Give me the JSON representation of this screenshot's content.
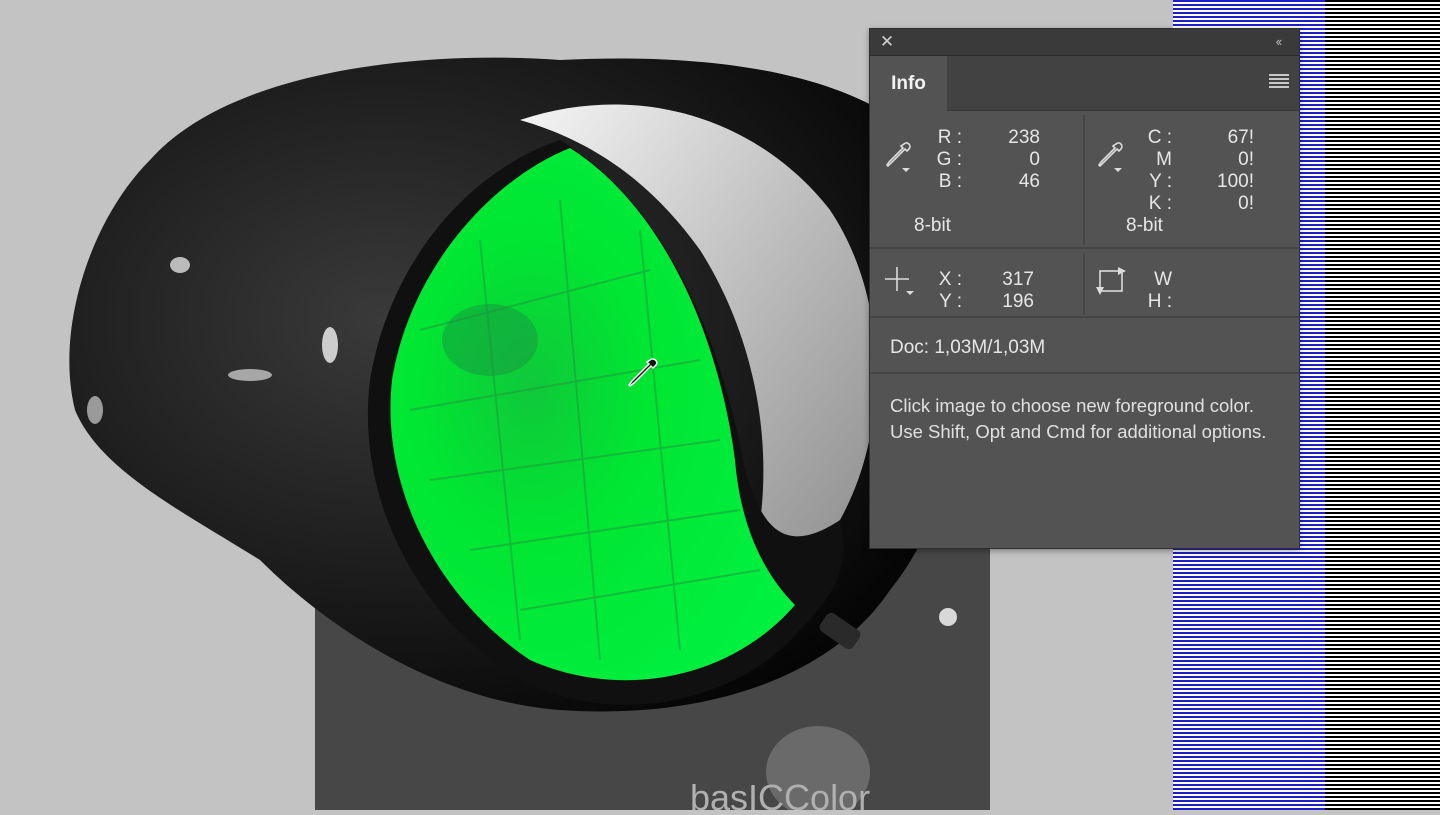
{
  "panel": {
    "tab_label": "Info",
    "color_left": {
      "labels": [
        "R :",
        "G :",
        "B :"
      ],
      "values": [
        "238",
        "0",
        "46"
      ],
      "bit_depth": "8-bit"
    },
    "color_right": {
      "labels": [
        "C :",
        "M :",
        "Y :",
        "K :"
      ],
      "values": [
        "67!",
        "0!",
        "100!",
        "0!"
      ],
      "bit_depth": "8-bit"
    },
    "position": {
      "labels": [
        "X :",
        "Y :"
      ],
      "values": [
        "317",
        "196"
      ]
    },
    "size": {
      "labels": [
        "W :",
        "H :"
      ],
      "values": [
        "",
        ""
      ]
    },
    "doc": "Doc: 1,03M/1,03M",
    "hint": "Click image to choose new foreground color.  Use Shift, Opt and Cmd for additional options."
  },
  "colors": {
    "panel_bg": "#535353",
    "highlight_green": "#00e632",
    "stripe_blue": "#1e1ec8"
  },
  "icons": {
    "close": "close-icon",
    "collapse": "collapse-icon",
    "menu": "panel-menu-icon",
    "eyedropper": "eyedropper-icon",
    "crosshair": "crosshair-icon",
    "selection_size": "selection-size-icon",
    "cursor": "eyedropper-cursor-icon"
  }
}
